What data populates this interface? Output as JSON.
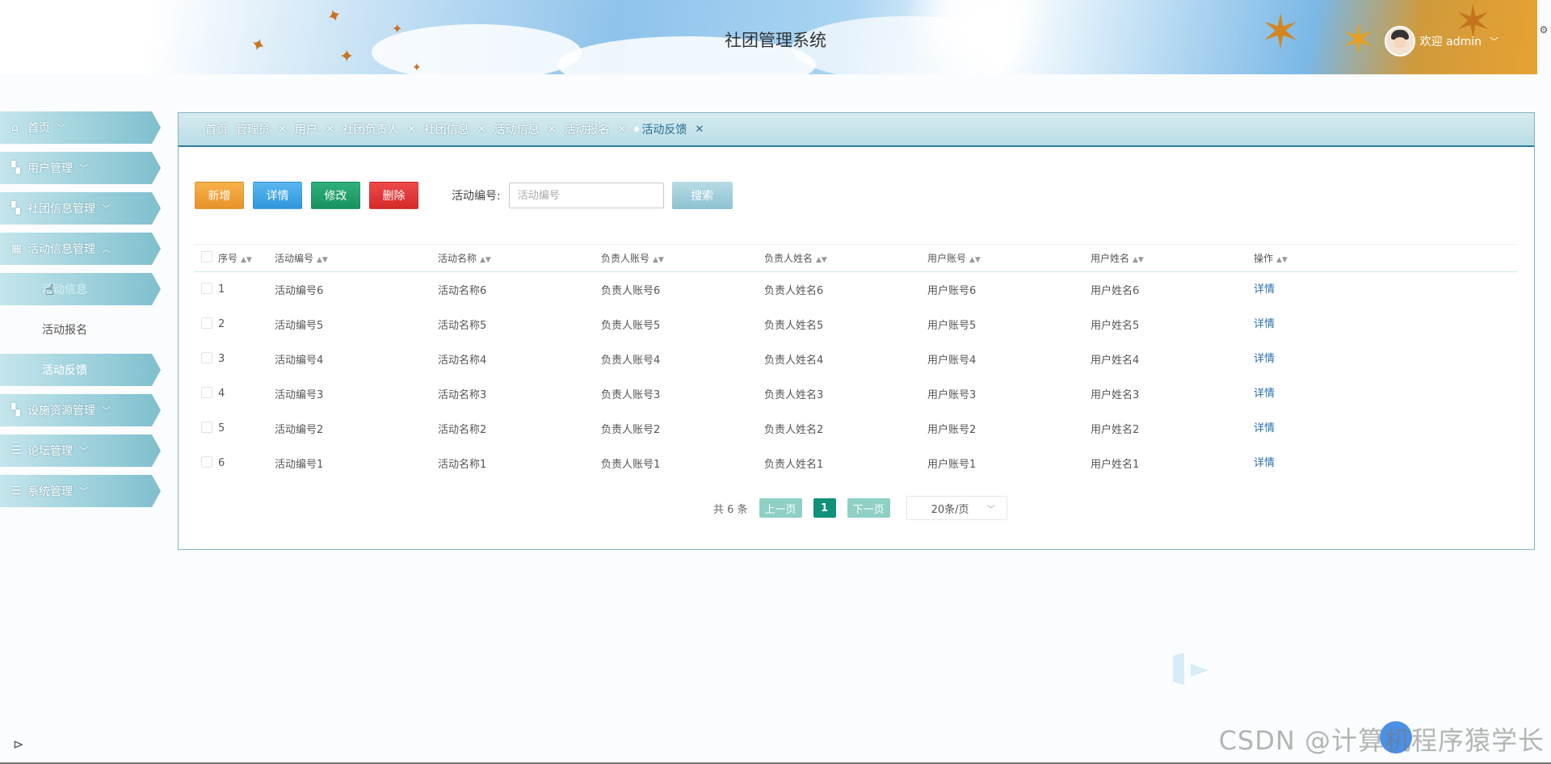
{
  "header": {
    "title": "社团管理系统",
    "user_greeting": "欢迎 admin"
  },
  "sidebar": {
    "items": [
      {
        "label": "首页",
        "icon": "home-icon"
      },
      {
        "label": "用户管理",
        "icon": "user-icon"
      },
      {
        "label": "社团信息管理",
        "icon": "user-icon"
      },
      {
        "label": "活动信息管理",
        "icon": "grid-icon",
        "expanded": true,
        "children": [
          {
            "label": "活动信息",
            "state": "hover"
          },
          {
            "label": "活动报名"
          },
          {
            "label": "活动反馈",
            "state": "active"
          }
        ]
      },
      {
        "label": "设施资源管理",
        "icon": "user-icon"
      },
      {
        "label": "论坛管理",
        "icon": "list-icon"
      },
      {
        "label": "系统管理",
        "icon": "list-icon"
      }
    ]
  },
  "tabs": [
    {
      "label": "首页",
      "closable": false
    },
    {
      "label": "管理员",
      "closable": true
    },
    {
      "label": "用户",
      "closable": true
    },
    {
      "label": "社团负责人",
      "closable": true
    },
    {
      "label": "社团信息",
      "closable": true
    },
    {
      "label": "活动信息",
      "closable": true
    },
    {
      "label": "活动报名",
      "closable": true
    },
    {
      "label": "活动反馈",
      "closable": true,
      "active": true
    }
  ],
  "toolbar": {
    "add": "新增",
    "detail": "详情",
    "edit": "修改",
    "delete": "删除",
    "search_label": "活动编号:",
    "search_placeholder": "活动编号",
    "search_button": "搜索"
  },
  "table": {
    "columns": [
      "序号",
      "活动编号",
      "活动名称",
      "负责人账号",
      "负责人姓名",
      "用户账号",
      "用户姓名",
      "操作"
    ],
    "rows": [
      [
        "1",
        "活动编号6",
        "活动名称6",
        "负责人账号6",
        "负责人姓名6",
        "用户账号6",
        "用户姓名6",
        "详情"
      ],
      [
        "2",
        "活动编号5",
        "活动名称5",
        "负责人账号5",
        "负责人姓名5",
        "用户账号5",
        "用户姓名5",
        "详情"
      ],
      [
        "3",
        "活动编号4",
        "活动名称4",
        "负责人账号4",
        "负责人姓名4",
        "用户账号4",
        "用户姓名4",
        "详情"
      ],
      [
        "4",
        "活动编号3",
        "活动名称3",
        "负责人账号3",
        "负责人姓名3",
        "用户账号3",
        "用户姓名3",
        "详情"
      ],
      [
        "5",
        "活动编号2",
        "活动名称2",
        "负责人账号2",
        "负责人姓名2",
        "用户账号2",
        "用户姓名2",
        "详情"
      ],
      [
        "6",
        "活动编号1",
        "活动名称1",
        "负责人账号1",
        "负责人姓名1",
        "用户账号1",
        "用户姓名1",
        "详情"
      ]
    ]
  },
  "pagination": {
    "total": "共 6 条",
    "prev": "上一页",
    "current": "1",
    "next": "下一页",
    "page_size": "20条/页"
  },
  "watermark": "CSDN @计算机程序猿学长",
  "colors": {
    "accent": "#2e7d98",
    "btn_add": "#e8912a",
    "btn_detail": "#2f97dd",
    "btn_edit": "#17925f",
    "btn_delete": "#d42a2a",
    "page_active": "#11907a"
  }
}
